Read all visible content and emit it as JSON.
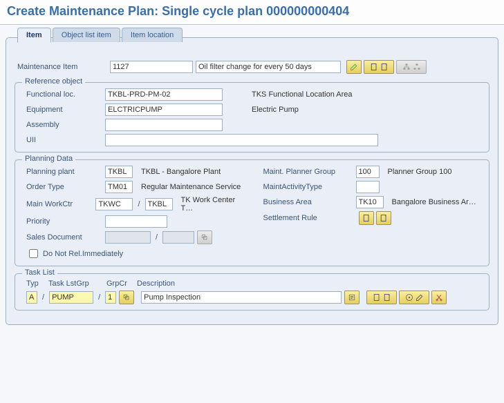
{
  "title": "Create Maintenance Plan: Single cycle plan 000000000404",
  "tabs": {
    "item": "Item",
    "objectList": "Object list item",
    "itemLocation": "Item location"
  },
  "maintItem": {
    "label": "Maintenance Item",
    "number": "1127",
    "desc": "Oil filter change for every 50 days"
  },
  "refObj": {
    "title": "Reference object",
    "funcLocLabel": "Functional loc.",
    "funcLoc": "TKBL-PRD-PM-02",
    "funcLocDesc": "TKS Functional Location Area",
    "equipLabel": "Equipment",
    "equip": "ELCTRICPUMP",
    "equipDesc": "Electric Pump",
    "assemblyLabel": "Assembly",
    "assembly": "",
    "uiiLabel": "UII",
    "uii": ""
  },
  "planning": {
    "title": "Planning Data",
    "plantLabel": "Planning plant",
    "plant": "TKBL",
    "plantDesc": "TKBL - Bangalore Plant",
    "orderTypeLabel": "Order Type",
    "orderType": "TM01",
    "orderTypeDesc": "Regular Maintenance Service",
    "workCtrLabel": "Main WorkCtr",
    "workCtr": "TKWC",
    "workCtrPlant": "TKBL",
    "workCtrDesc": "TK Work Center T…",
    "priorityLabel": "Priority",
    "priority": "",
    "salesDocLabel": "Sales Document",
    "salesDoc": "",
    "salesDocItem": "",
    "doNotRelLabel": "Do Not Rel.Immediately",
    "plannerGroupLabel": "Maint. Planner Group",
    "plannerGroup": "100",
    "plannerGroupDesc": "Planner Group 100",
    "activityTypeLabel": "MaintActivityType",
    "activityType": "",
    "businessAreaLabel": "Business Area",
    "businessArea": "TK10",
    "businessAreaDesc": "Bangalore Business Ar…",
    "settlementRuleLabel": "Settlement Rule"
  },
  "taskList": {
    "title": "Task List",
    "hTyp": "Typ",
    "hGroup": "Task LstGrp",
    "hCounter": "GrpCr",
    "hDesc": "Description",
    "typ": "A",
    "group": "PUMP",
    "counter": "1",
    "desc": "Pump Inspection"
  }
}
